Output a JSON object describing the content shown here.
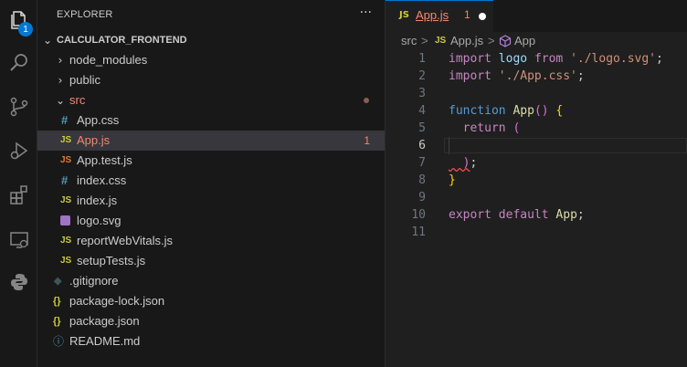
{
  "colors": {
    "accent": "#0078d4",
    "js_icon": "#cbcb41",
    "css_icon": "#519aba",
    "error": "#f48771",
    "modified": "#e2c08d"
  },
  "activity_bar": {
    "items": [
      {
        "icon": "explorer-files-icon",
        "badge": "1"
      },
      {
        "icon": "search-icon"
      },
      {
        "icon": "source-control-icon"
      },
      {
        "icon": "run-debug-icon"
      },
      {
        "icon": "extensions-icon"
      },
      {
        "icon": "remote-explorer-icon"
      },
      {
        "icon": "python-icon"
      }
    ]
  },
  "sidebar": {
    "title": "EXPLORER",
    "more": "···",
    "root": "CALCULATOR_FRONTEND",
    "items": [
      {
        "label": "node_modules",
        "type": "folder",
        "icon": "chevron-right-icon"
      },
      {
        "label": "public",
        "type": "folder",
        "icon": "chevron-right-icon"
      },
      {
        "label": "src",
        "type": "folder-open",
        "icon": "chevron-down-icon"
      },
      {
        "label": "App.css",
        "type": "css",
        "icon_text": "#"
      },
      {
        "label": "App.js",
        "type": "js",
        "icon_text": "JS",
        "count": "1"
      },
      {
        "label": "App.test.js",
        "type": "js",
        "icon_text": "JS"
      },
      {
        "label": "index.css",
        "type": "css",
        "icon_text": "#"
      },
      {
        "label": "index.js",
        "type": "js",
        "icon_text": "JS"
      },
      {
        "label": "logo.svg",
        "type": "svg",
        "icon_text": ""
      },
      {
        "label": "reportWebVitals.js",
        "type": "js",
        "icon_text": "JS"
      },
      {
        "label": "setupTests.js",
        "type": "js",
        "icon_text": "JS"
      },
      {
        "label": ".gitignore",
        "type": "git",
        "icon_text": "◆"
      },
      {
        "label": "package-lock.json",
        "type": "json",
        "icon_text": "{}"
      },
      {
        "label": "package.json",
        "type": "json",
        "icon_text": "{}"
      },
      {
        "label": "README.md",
        "type": "info",
        "icon_text": "ⓘ"
      }
    ]
  },
  "editor": {
    "tab": {
      "icon_text": "JS",
      "name": "App.js",
      "count": "1"
    },
    "breadcrumb": {
      "folder": "src",
      "sep1": ">",
      "file_icon": "JS",
      "file": "App.js",
      "sep2": ">",
      "symbol_icon": "symbol-method-icon",
      "symbol": "App"
    },
    "line_numbers": [
      "1",
      "2",
      "3",
      "4",
      "5",
      "6",
      "7",
      "8",
      "9",
      "10",
      "11"
    ],
    "lines": [
      {
        "t1": "import",
        "t2": " logo ",
        "t3": "from",
        "t4": " './logo.svg'",
        "t5": ";"
      },
      {
        "t1": "import",
        "t2": " './App.css'",
        "t3": ";"
      },
      {},
      {
        "t1": "function",
        "t2": " App",
        "t3": "()",
        "t4": " {"
      },
      {
        "t1": "  return",
        "t2": " ("
      },
      {},
      {
        "t1": "  )",
        "t2": ";"
      },
      {
        "t1": "}"
      },
      {},
      {
        "t1": "export",
        "t2": " default",
        "t3": " App",
        "t4": ";"
      },
      {}
    ]
  }
}
